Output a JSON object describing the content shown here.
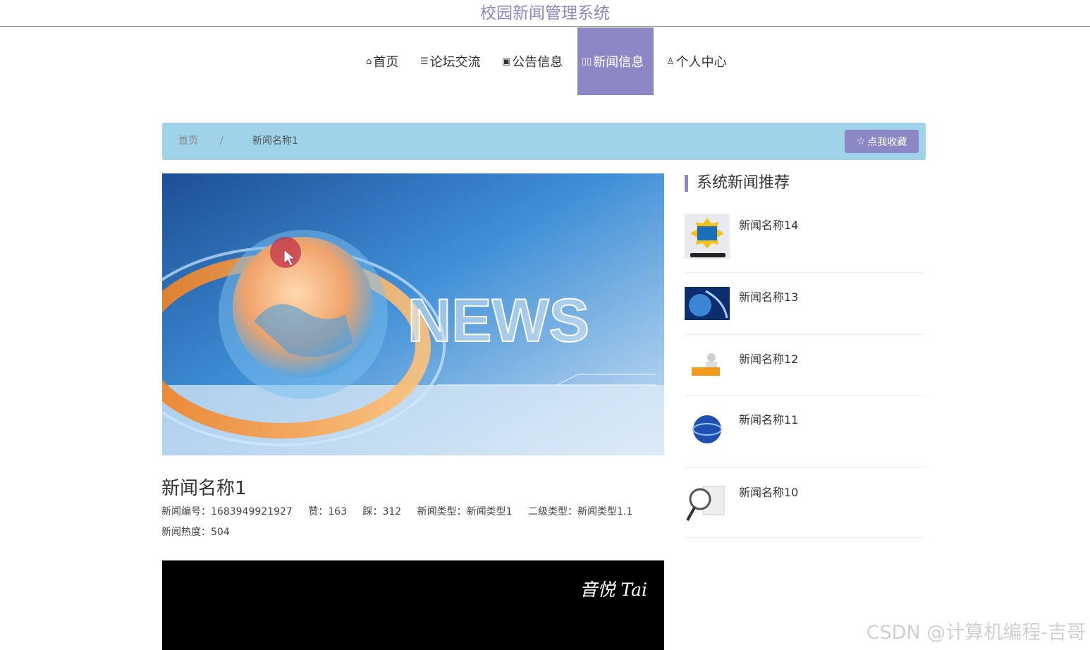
{
  "site": {
    "title": "校园新闻管理系统"
  },
  "nav": {
    "items": [
      {
        "label": "首页",
        "icon": "home-icon"
      },
      {
        "label": "论坛交流",
        "icon": "forum-icon"
      },
      {
        "label": "公告信息",
        "icon": "notice-icon"
      },
      {
        "label": "新闻信息",
        "icon": "news-icon",
        "active": true
      },
      {
        "label": "个人中心",
        "icon": "user-icon"
      }
    ]
  },
  "breadcrumb": {
    "home": "首页",
    "separator": "/",
    "current": "新闻名称1"
  },
  "favorite": {
    "label": "点我收藏",
    "icon": "star-icon"
  },
  "hero": {
    "text": "NEWS"
  },
  "article": {
    "title": "新闻名称1",
    "id_label": "新闻编号：",
    "id_value": "1683949921927",
    "likes_label": "赞：",
    "likes_value": "163",
    "dislikes_label": "踩：",
    "dislikes_value": "312",
    "type_label": "新闻类型：",
    "type_value": "新闻类型1",
    "subtype_label": "二级类型：",
    "subtype_value": "新闻类型1.1",
    "heat_label": "新闻热度：",
    "heat_value": "504"
  },
  "video": {
    "watermark": "音悦 Tai"
  },
  "sidebar": {
    "title": "系统新闻推荐",
    "items": [
      {
        "label": "新闻名称14"
      },
      {
        "label": "新闻名称13"
      },
      {
        "label": "新闻名称12"
      },
      {
        "label": "新闻名称11"
      },
      {
        "label": "新闻名称10"
      }
    ]
  },
  "watermark": "CSDN @计算机编程-吉哥",
  "colors": {
    "accent": "#8c87c5",
    "breadcrumb_bg": "#9fd3ea",
    "title": "#8e86c2"
  }
}
